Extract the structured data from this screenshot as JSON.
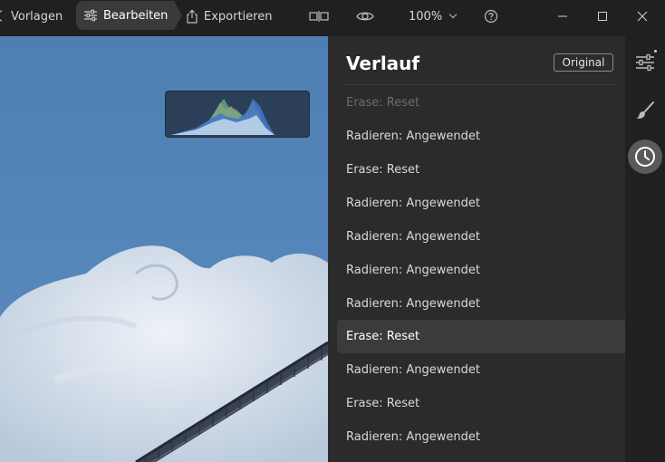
{
  "toolbar": {
    "vorlagen_label": "Vorlagen",
    "bearbeiten_label": "Bearbeiten",
    "exportieren_label": "Exportieren",
    "zoom_value": "100%"
  },
  "panel": {
    "title": "Verlauf",
    "original_button": "Original",
    "history": [
      {
        "label": "Erase: Reset",
        "state": "dim"
      },
      {
        "label": "Radieren: Angewendet",
        "state": "normal"
      },
      {
        "label": "Erase: Reset",
        "state": "normal"
      },
      {
        "label": "Radieren: Angewendet",
        "state": "normal"
      },
      {
        "label": "Radieren: Angewendet",
        "state": "normal"
      },
      {
        "label": "Radieren: Angewendet",
        "state": "normal"
      },
      {
        "label": "Radieren: Angewendet",
        "state": "normal"
      },
      {
        "label": "Erase: Reset",
        "state": "selected"
      },
      {
        "label": "Radieren: Angewendet",
        "state": "normal"
      },
      {
        "label": "Erase: Reset",
        "state": "normal"
      },
      {
        "label": "Radieren: Angewendet",
        "state": "normal"
      }
    ]
  },
  "icons": {
    "bearbeiten": "sliders-icon",
    "exportieren": "share-icon",
    "compare": "split-view-icon",
    "preview": "eye-icon",
    "help": "question-circle-icon",
    "strip_adjust": "sliders-icon",
    "strip_brush": "brush-icon",
    "strip_history": "clock-icon"
  },
  "colors": {
    "app_bg": "#202020",
    "panel_bg": "#2b2b2b",
    "selected_row": "#3b3b3b",
    "sky": "#4f80b4",
    "histogram_bg": "#2b3f58"
  }
}
